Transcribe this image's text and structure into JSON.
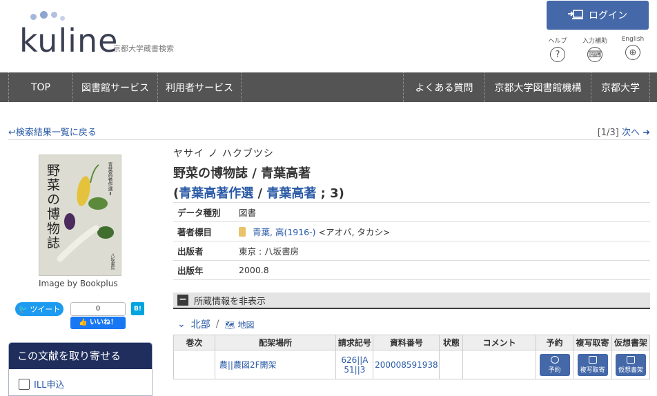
{
  "header": {
    "logo_text": "kuline",
    "tagline": "京都大学蔵書検索",
    "login_label": "ログイン",
    "utils": [
      {
        "label": "ヘルプ",
        "icon": "?"
      },
      {
        "label": "入力補助",
        "icon": "⌨"
      },
      {
        "label": "English",
        "icon": "⊕"
      }
    ]
  },
  "nav": {
    "left": [
      "TOP",
      "図書館サービス",
      "利用者サービス"
    ],
    "right": [
      "よくある質問",
      "京都大学図書館機構",
      "京都大学"
    ]
  },
  "crumbs": {
    "back_label": "検索結果一覧に戻る",
    "page_count": "[1/3]",
    "next_label": "次へ"
  },
  "cover": {
    "title": "野菜の博物誌",
    "subtitle": "青葉高著作選Ⅱ",
    "publisher": "八坂書房",
    "credit": "Image by Bookplus"
  },
  "social": {
    "tweet_label": "ツイート",
    "fb_count": "0",
    "fb_like": "いいね！",
    "hatena": "B!"
  },
  "order_box": {
    "heading": "この文献を取り寄せる",
    "item": "ILL申込"
  },
  "book": {
    "kana": "ヤサイ ノ ハクブツシ",
    "title": "野菜の博物誌 / 青葉高著",
    "series_open": "(",
    "series_name": "青葉高著作選",
    "series_sep": " / ",
    "series_author": "青葉高著",
    "series_close": " ; 3)"
  },
  "meta": [
    {
      "key": "データ種別",
      "value": "図書"
    },
    {
      "key": "著者標目",
      "link": "青葉, 高(1916-)",
      "value": " <アオバ, タカシ>"
    },
    {
      "key": "出版者",
      "value": "東京 : 八坂書房"
    },
    {
      "key": "出版年",
      "value": "2000.8"
    }
  ],
  "holdings": {
    "toggle_label": "所蔵情報を非表示",
    "location": "北部",
    "map_label": "地図",
    "columns": [
      "巻次",
      "配架場所",
      "請求記号",
      "資料番号",
      "状態",
      "コメント",
      "予約",
      "複写取寄",
      "仮想書架"
    ],
    "row": {
      "volume": "",
      "shelf": "農||農図2F開架",
      "call_no_1": "626||A",
      "call_no_2": "51||3",
      "item_no": "200008591938",
      "status": "",
      "comment": "",
      "reserve": "予約",
      "copy": "複写取寄",
      "shelf_virtual": "仮想書架"
    }
  },
  "colors": {
    "nav_bg": "#545454",
    "accent": "#4468a8",
    "link": "#2a5aa6",
    "order_head": "#1f2e5c"
  }
}
